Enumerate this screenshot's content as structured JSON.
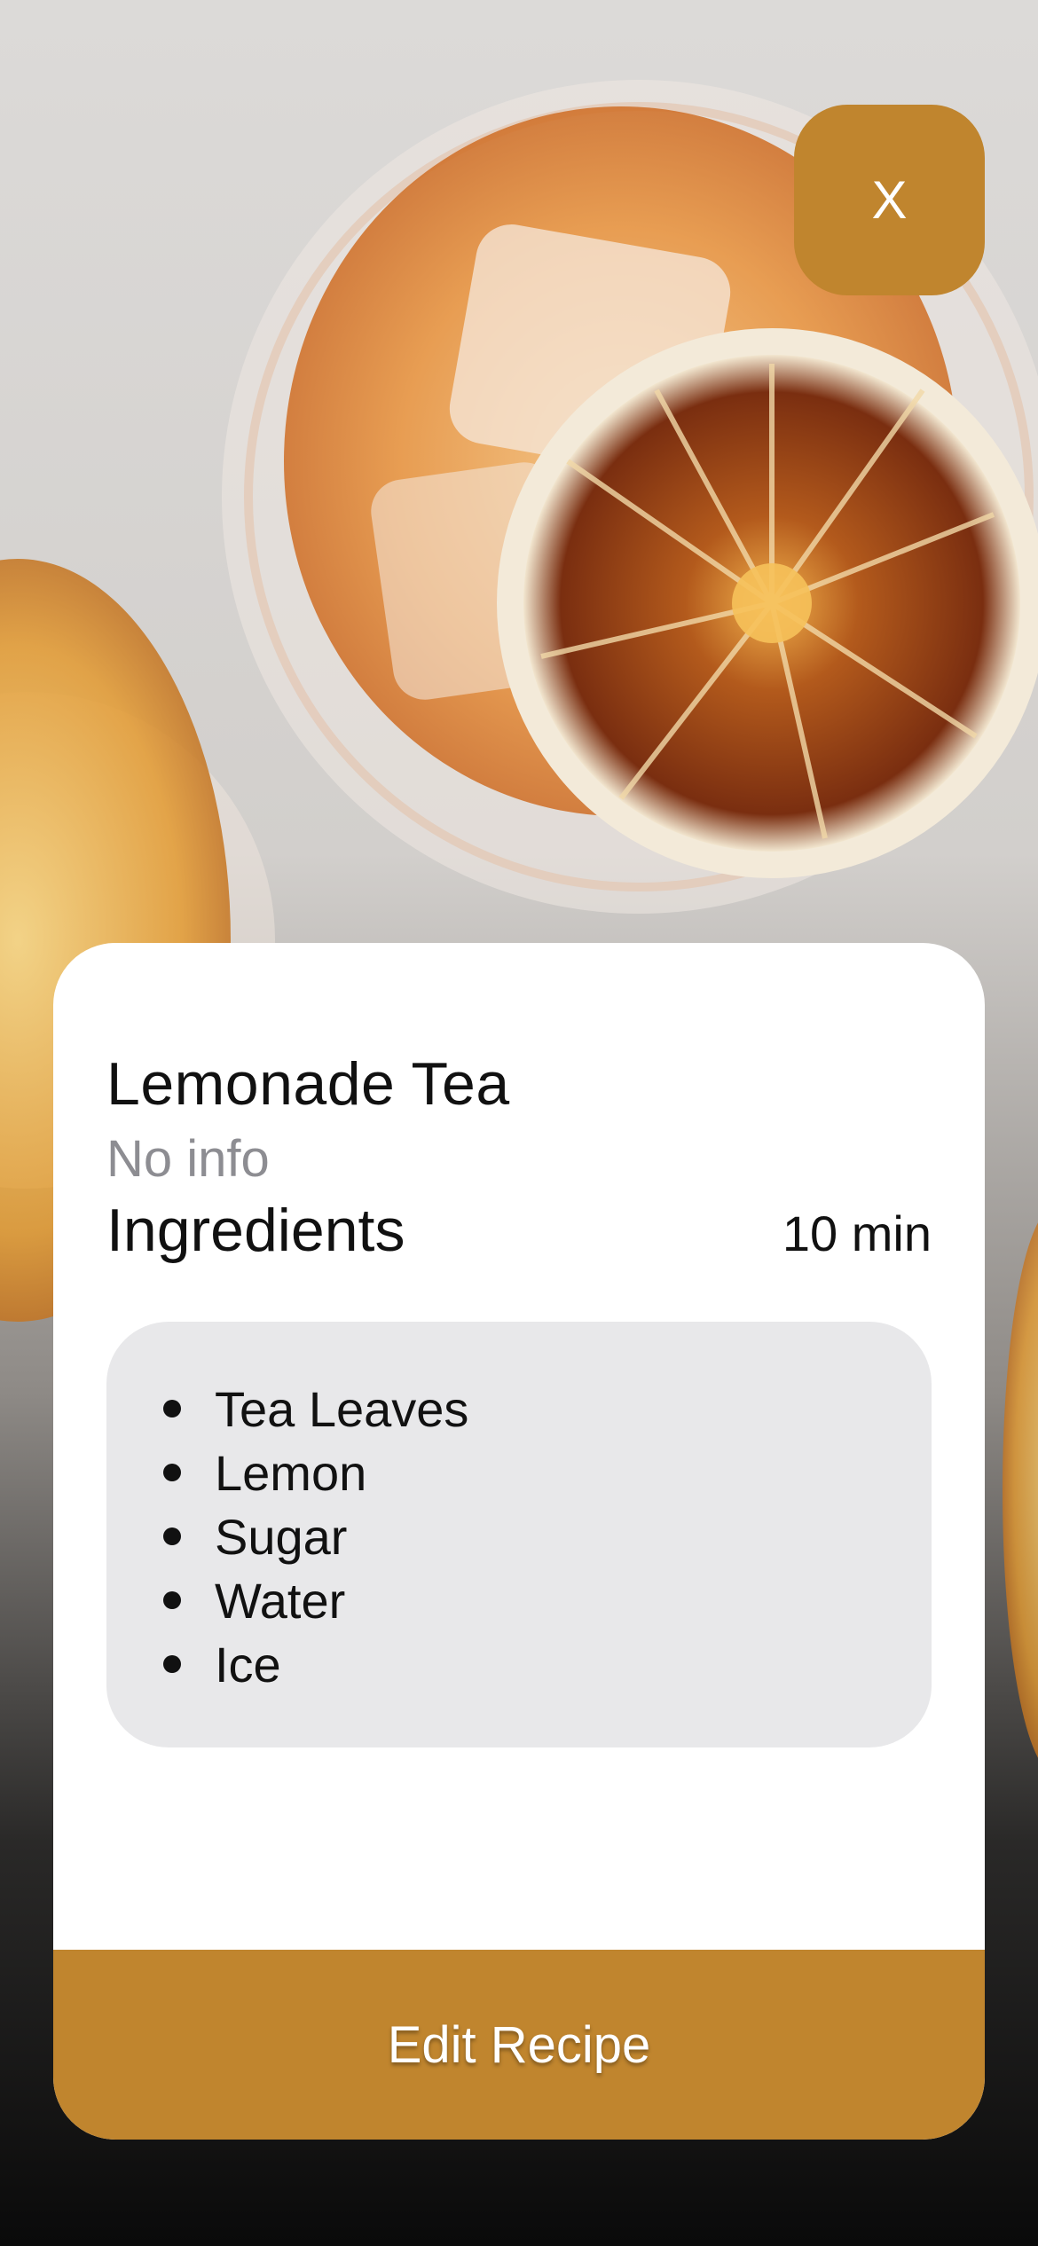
{
  "header": {
    "close_label": "X"
  },
  "recipe": {
    "title": "Lemonade Tea",
    "info": "No info",
    "ingredients_heading": "Ingredients",
    "duration": "10 min",
    "ingredients": [
      "Tea Leaves",
      "Lemon",
      "Sugar",
      "Water",
      "Ice"
    ]
  },
  "actions": {
    "edit_label": "Edit Recipe"
  },
  "colors": {
    "accent": "#c0852e",
    "card_bg": "#ffffff",
    "list_bg": "#e8e8ea",
    "muted_text": "#8d8d92"
  },
  "icons": {
    "close": "close-icon",
    "bullet": "bullet-icon"
  }
}
